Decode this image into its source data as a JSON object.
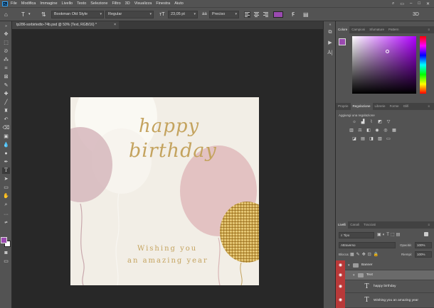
{
  "app": {
    "logo": "Ps"
  },
  "menu": [
    "File",
    "Modifica",
    "Immagine",
    "Livello",
    "Testo",
    "Selezione",
    "Filtro",
    "3D",
    "Visualizza",
    "Finestra",
    "Aiuto"
  ],
  "options": {
    "font_family": "Bookman Old Style",
    "font_style": "Regular",
    "font_size": "23,05 pt",
    "antialias": "Preciso",
    "text_color": "#9a4ab0"
  },
  "document": {
    "tab_title": "tp286-sorbirtedto-74b.psd @ 50% (Text, RGB/16) *",
    "close": "×"
  },
  "artwork": {
    "line1": "happy",
    "line2": "birthday",
    "wishing1": "Wishing you",
    "wishing2": "an amazing year"
  },
  "panels": {
    "color_tabs": [
      "Colore",
      "Campioni",
      "Sfumature",
      "Pattern"
    ],
    "adjust_tabs": [
      "Proprie",
      "Regolazione",
      "Librerie",
      "Forme",
      "Glifi"
    ],
    "adjust_title": "Aggiungi una regolazione",
    "layers_tabs": [
      "Livelli",
      "Canali",
      "Tracciati"
    ],
    "filter_kind": "Tipo",
    "blend_mode": "Attraverso",
    "opacity_label": "Opacità:",
    "opacity_value": "100%",
    "lock_label": "Blocca:",
    "fill_label": "Riempi:",
    "fill_value": "100%",
    "layers": [
      {
        "name": "Banner",
        "type": "group"
      },
      {
        "name": "Text",
        "type": "group"
      },
      {
        "name": "happy birthday",
        "type": "text"
      },
      {
        "name": "Wishing you an amazing year",
        "type": "text"
      }
    ]
  }
}
